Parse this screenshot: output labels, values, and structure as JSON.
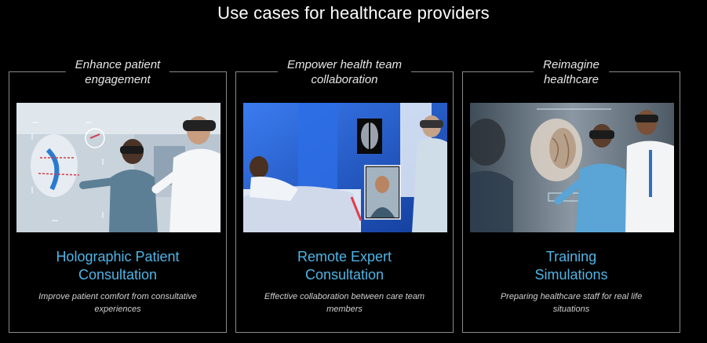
{
  "page": {
    "title": "Use cases for healthcare providers"
  },
  "cards": [
    {
      "heading": [
        "Enhance patient",
        "engagement"
      ],
      "title": [
        "Holographic Patient",
        "Consultation"
      ],
      "description": [
        "Improve patient comfort from consultative",
        "experiences"
      ]
    },
    {
      "heading": [
        "Empower health team",
        "collaboration"
      ],
      "title": [
        "Remote Expert",
        "Consultation"
      ],
      "description": [
        "Effective collaboration between care team",
        "members"
      ]
    },
    {
      "heading": [
        "Reimagine",
        "healthcare"
      ],
      "title": [
        "Training",
        "Simulations"
      ],
      "description": [
        "Preparing healthcare staff for real life",
        "situations"
      ]
    }
  ],
  "colors": {
    "background": "#000000",
    "accent_title": "#4fb5e6",
    "border": "#8a8a8a"
  }
}
